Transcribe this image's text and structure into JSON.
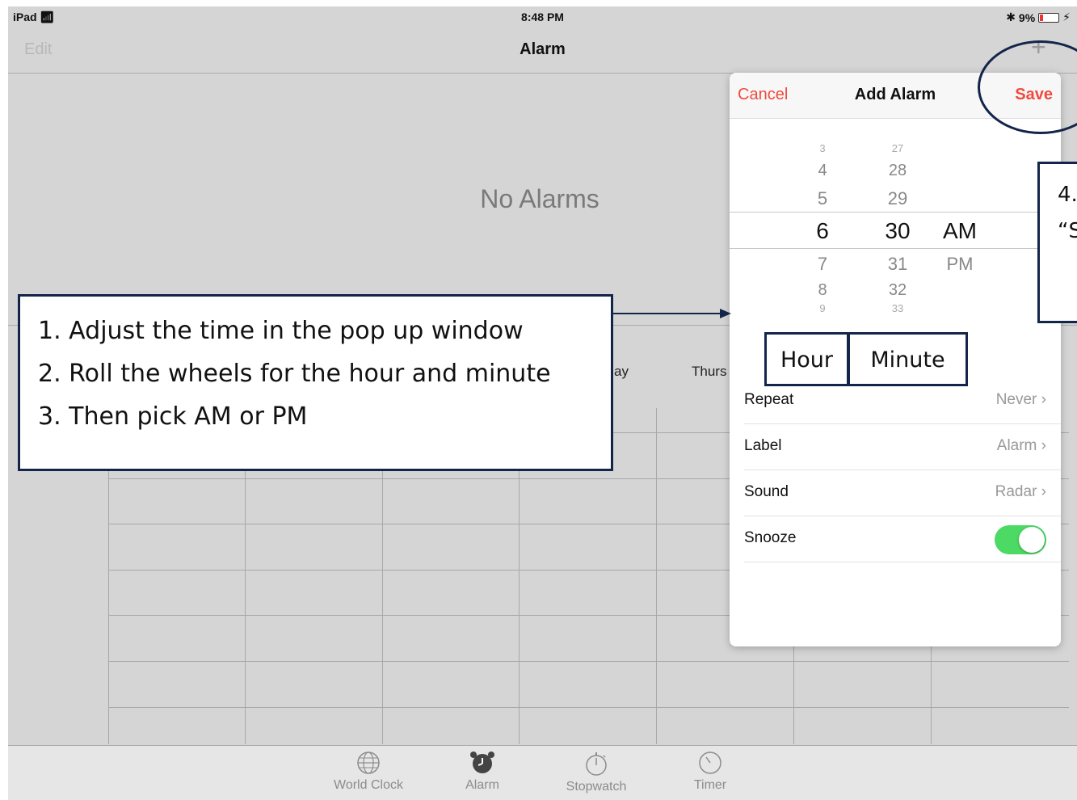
{
  "status_bar": {
    "device": "iPad",
    "time": "8:48 PM",
    "battery": "9%"
  },
  "nav": {
    "edit_label": "Edit",
    "title": "Alarm",
    "add_label": "+"
  },
  "empty_message": "No Alarms",
  "background_table": {
    "day_partial_1": "ay",
    "day_partial_2": "Thurs"
  },
  "tab_bar": {
    "items": [
      {
        "label": "World Clock",
        "icon": "globe-icon"
      },
      {
        "label": "Alarm",
        "icon": "alarm-clock-icon",
        "active": true
      },
      {
        "label": "Stopwatch",
        "icon": "stopwatch-icon"
      },
      {
        "label": "Timer",
        "icon": "timer-icon"
      }
    ]
  },
  "popup": {
    "cancel_label": "Cancel",
    "title": "Add Alarm",
    "save_label": "Save",
    "picker": {
      "hours": [
        "3",
        "4",
        "5",
        "6",
        "7",
        "8",
        "9"
      ],
      "minutes": [
        "27",
        "28",
        "29",
        "30",
        "31",
        "32",
        "33"
      ],
      "periods": [
        "AM",
        "PM"
      ],
      "selected_hour": "6",
      "selected_minute": "30",
      "selected_period": "AM"
    },
    "rows": [
      {
        "label": "Repeat",
        "value": "Never"
      },
      {
        "label": "Label",
        "value": "Alarm"
      },
      {
        "label": "Sound",
        "value": "Radar"
      },
      {
        "label": "Snooze",
        "value": "",
        "toggle": true,
        "toggle_on": true
      }
    ],
    "toggle_color": "#4cd964",
    "accent_color": "#f04a3e"
  },
  "annotations": {
    "instructions": [
      "1. Adjust the time in the pop up window",
      "2. Roll the wheels for the hour and minute",
      "3. Then pick AM or PM"
    ],
    "hour_label": "Hour",
    "minute_label": "Minute",
    "save_step_line1": "4.",
    "save_step_line2": "“S",
    "border_color": "#13254a"
  }
}
